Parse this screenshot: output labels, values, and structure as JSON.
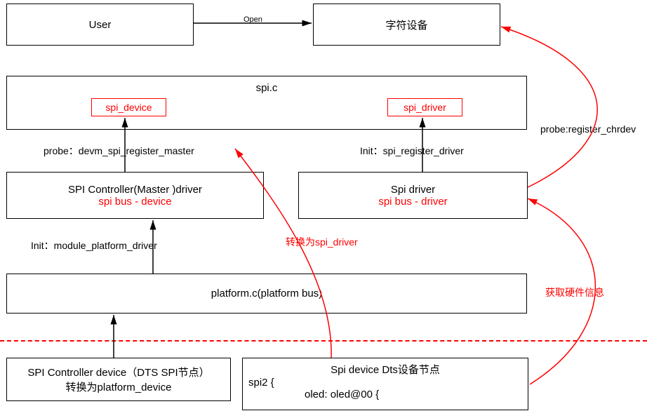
{
  "boxes": {
    "user": "User",
    "chardev": "字符设备",
    "spic": "spi.c",
    "spi_device": "spi_device",
    "spi_driver": "spi_driver",
    "controller_driver_line1": "SPI Controller(Master )driver",
    "controller_driver_line2": "spi bus - device",
    "driver_line1": "Spi driver",
    "driver_line2": "spi bus - driver",
    "platform": "platform.c(platform bus)",
    "dts_spi_line1": "SPI Controller device（DTS SPI节点）",
    "dts_spi_line2": "转换为platform_device",
    "dts_device_line1": "Spi device Dts设备节点",
    "dts_device_line2": "spi2 {",
    "dts_device_line3": "oled: oled@00 {"
  },
  "labels": {
    "open": "Open",
    "probe_master": "probe：devm_spi_register_master",
    "init_driver": "Init：spi_register_driver",
    "init_module": "Init：module_platform_driver",
    "convert_driver": "转换为spi_driver",
    "probe_chrdev": "probe:register_chrdev",
    "get_hw": "获取硬件信息"
  }
}
